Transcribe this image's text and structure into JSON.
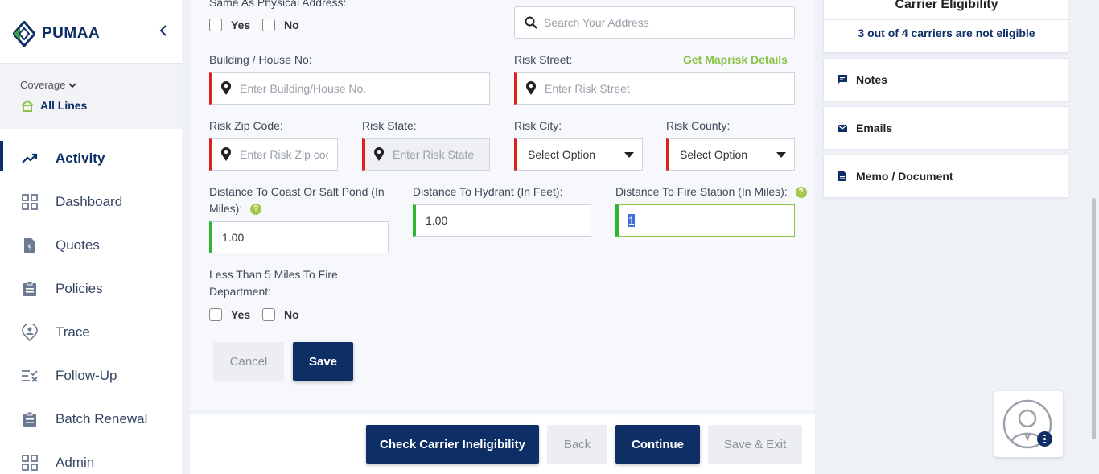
{
  "app": {
    "name": "PUMAA"
  },
  "sidebar": {
    "coverage_label": "Coverage",
    "coverage_value": "All Lines",
    "items": [
      {
        "label": "Activity",
        "icon": "trending-icon",
        "active": true
      },
      {
        "label": "Dashboard",
        "icon": "grid-icon"
      },
      {
        "label": "Quotes",
        "icon": "quote-doc-icon"
      },
      {
        "label": "Policies",
        "icon": "clipboard-icon"
      },
      {
        "label": "Trace",
        "icon": "location-person-icon"
      },
      {
        "label": "Follow-Up",
        "icon": "checklist-icon"
      },
      {
        "label": "Batch Renewal",
        "icon": "clipboard-icon"
      },
      {
        "label": "Admin",
        "icon": "grid-icon"
      }
    ]
  },
  "form": {
    "same_as_physical_label": "Same As Physical Address:",
    "yes": "Yes",
    "no": "No",
    "search_placeholder": "Search Your Address",
    "building_label": "Building / House No:",
    "building_placeholder": "Enter Building/House No.",
    "risk_street_label": "Risk Street:",
    "maprisk_link": "Get Maprisk Details",
    "risk_street_placeholder": "Enter Risk Street",
    "zip_label": "Risk Zip Code:",
    "zip_placeholder": "Enter Risk Zip coc",
    "state_label": "Risk State:",
    "state_placeholder": "Enter Risk State",
    "city_label": "Risk City:",
    "city_value": "Select Option",
    "county_label": "Risk County:",
    "county_value": "Select Option",
    "coast_label_1": "Distance To Coast Or Salt Pond (In",
    "coast_label_2": "Miles):",
    "coast_value": "1.00",
    "hydrant_label": "Distance To Hydrant (In Feet):",
    "hydrant_value": "1.00",
    "fire_station_label": "Distance To Fire Station (In Miles):",
    "fire_station_value": "1",
    "less_than_label_1": "Less Than 5 Miles To Fire",
    "less_than_label_2": "Department:",
    "cancel": "Cancel",
    "save": "Save",
    "help_glyph": "?"
  },
  "footer": {
    "check_ineligibility": "Check Carrier Ineligibility",
    "back": "Back",
    "continue": "Continue",
    "save_exit": "Save & Exit"
  },
  "right_panel": {
    "eligibility_title": "Carrier Eligibility",
    "eligibility_text": "3 out of 4 carriers are not eligible",
    "notes": "Notes",
    "emails": "Emails",
    "memo": "Memo / Document"
  },
  "colors": {
    "brand": "#0d2f66",
    "accent_green": "#8bc34a",
    "required_red": "#e0201a",
    "valid_green": "#2fb630"
  }
}
